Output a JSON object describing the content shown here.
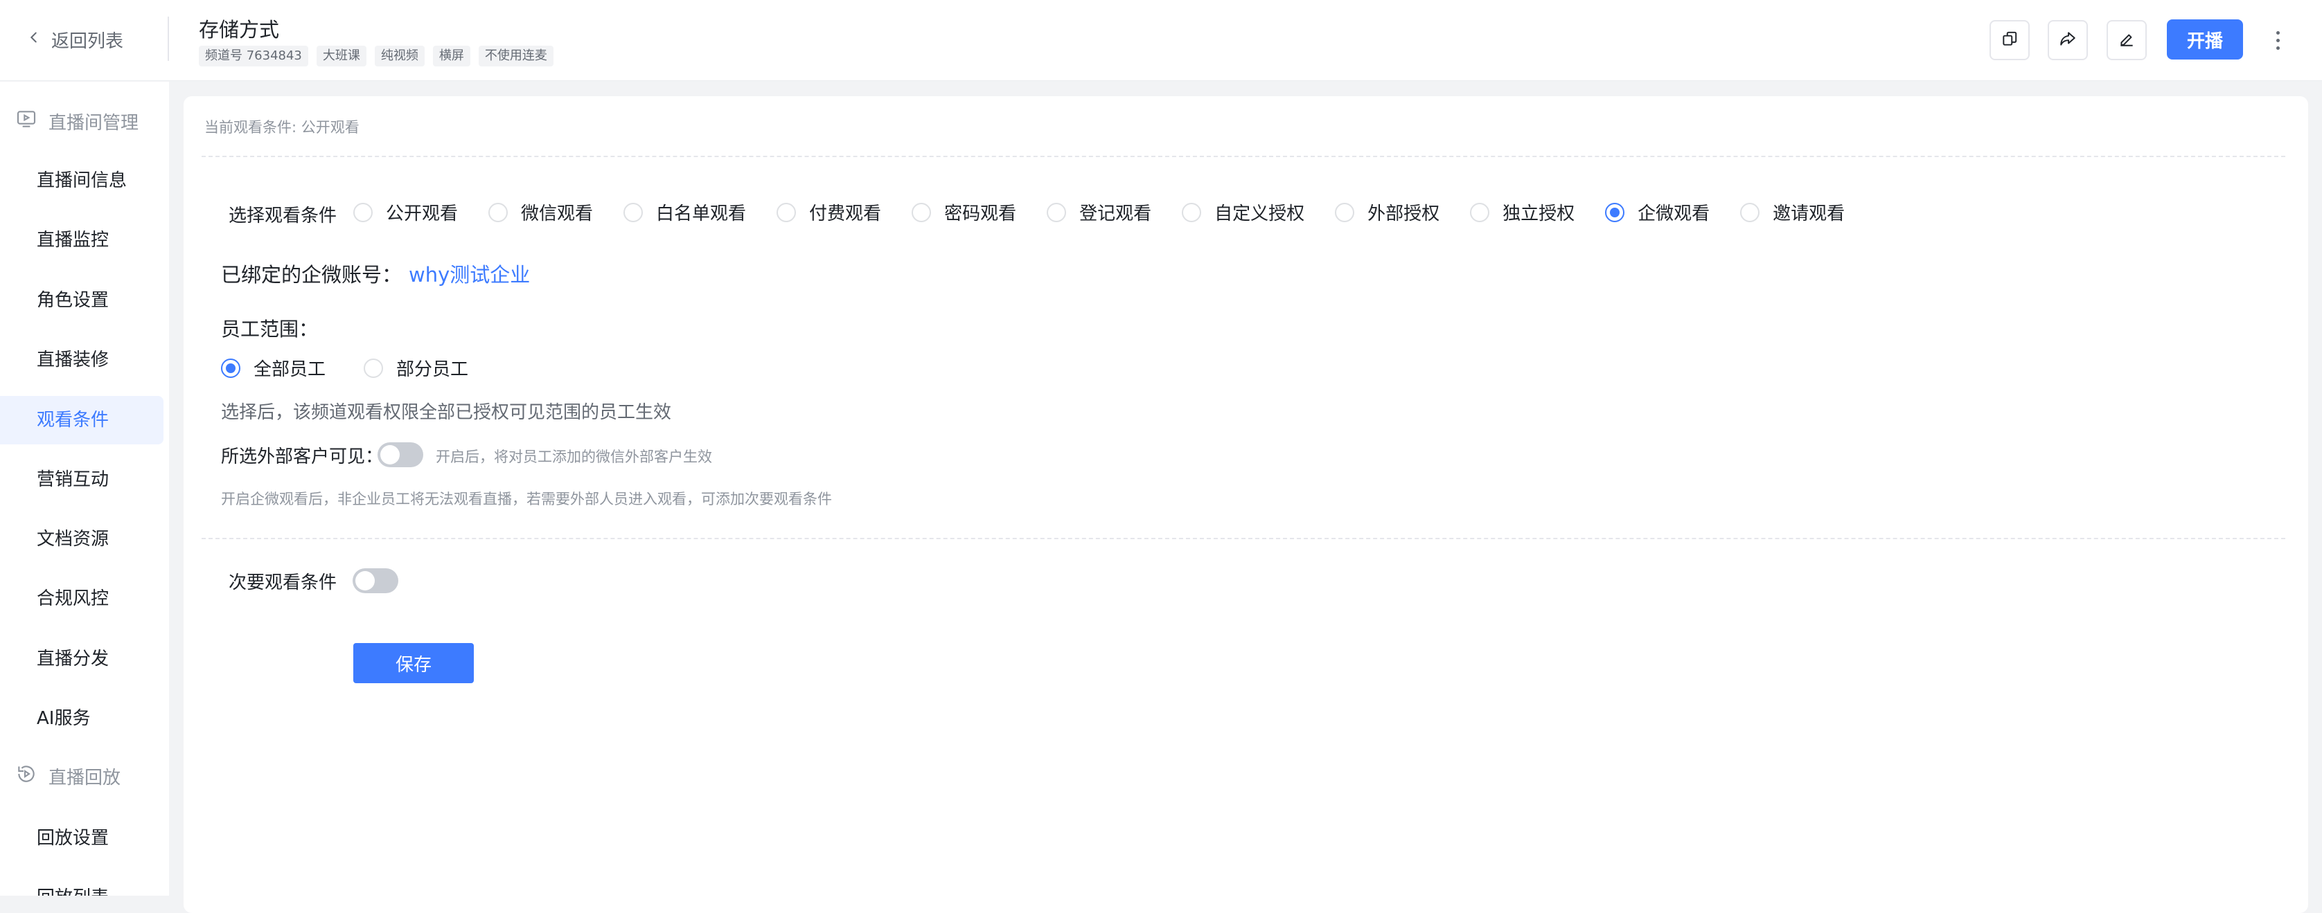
{
  "header": {
    "back_label": "返回列表",
    "title": "存储方式",
    "tags": [
      "频道号 7634843",
      "大班课",
      "纯视频",
      "横屏",
      "不使用连麦"
    ],
    "start_label": "开播",
    "accent_color": "#3d7bff"
  },
  "sidebar": {
    "group_live": "直播间管理",
    "items_live": [
      "直播间信息",
      "直播监控",
      "角色设置",
      "直播装修",
      "观看条件",
      "营销互动",
      "文档资源",
      "合规风控",
      "直播分发",
      "AI服务"
    ],
    "active_item": "观看条件",
    "group_replay": "直播回放",
    "items_replay": [
      "回放设置",
      "回放列表"
    ]
  },
  "main": {
    "current_condition": "当前观看条件: 公开观看",
    "select_label": "选择观看条件",
    "options": [
      "公开观看",
      "微信观看",
      "白名单观看",
      "付费观看",
      "密码观看",
      "登记观看",
      "自定义授权",
      "外部授权",
      "独立授权",
      "企微观看",
      "邀请观看"
    ],
    "selected_option": "企微观看",
    "bound_label": "已绑定的企微账号：",
    "bound_value": "why测试企业",
    "staff_scope_label": "员工范围：",
    "staff_options": [
      "全部员工",
      "部分员工"
    ],
    "staff_selected": "全部员工",
    "staff_hint": "选择后，该频道观看权限全部已授权可见范围的员工生效",
    "external_label": "所选外部客户可见：",
    "external_hint": "开启后，将对员工添加的微信外部客户生效",
    "external_enabled": false,
    "notice": "开启企微观看后，非企业员工将无法观看直播，若需要外部人员进入观看，可添加次要观看条件",
    "secondary_label": "次要观看条件",
    "secondary_enabled": false,
    "save_label": "保存"
  }
}
